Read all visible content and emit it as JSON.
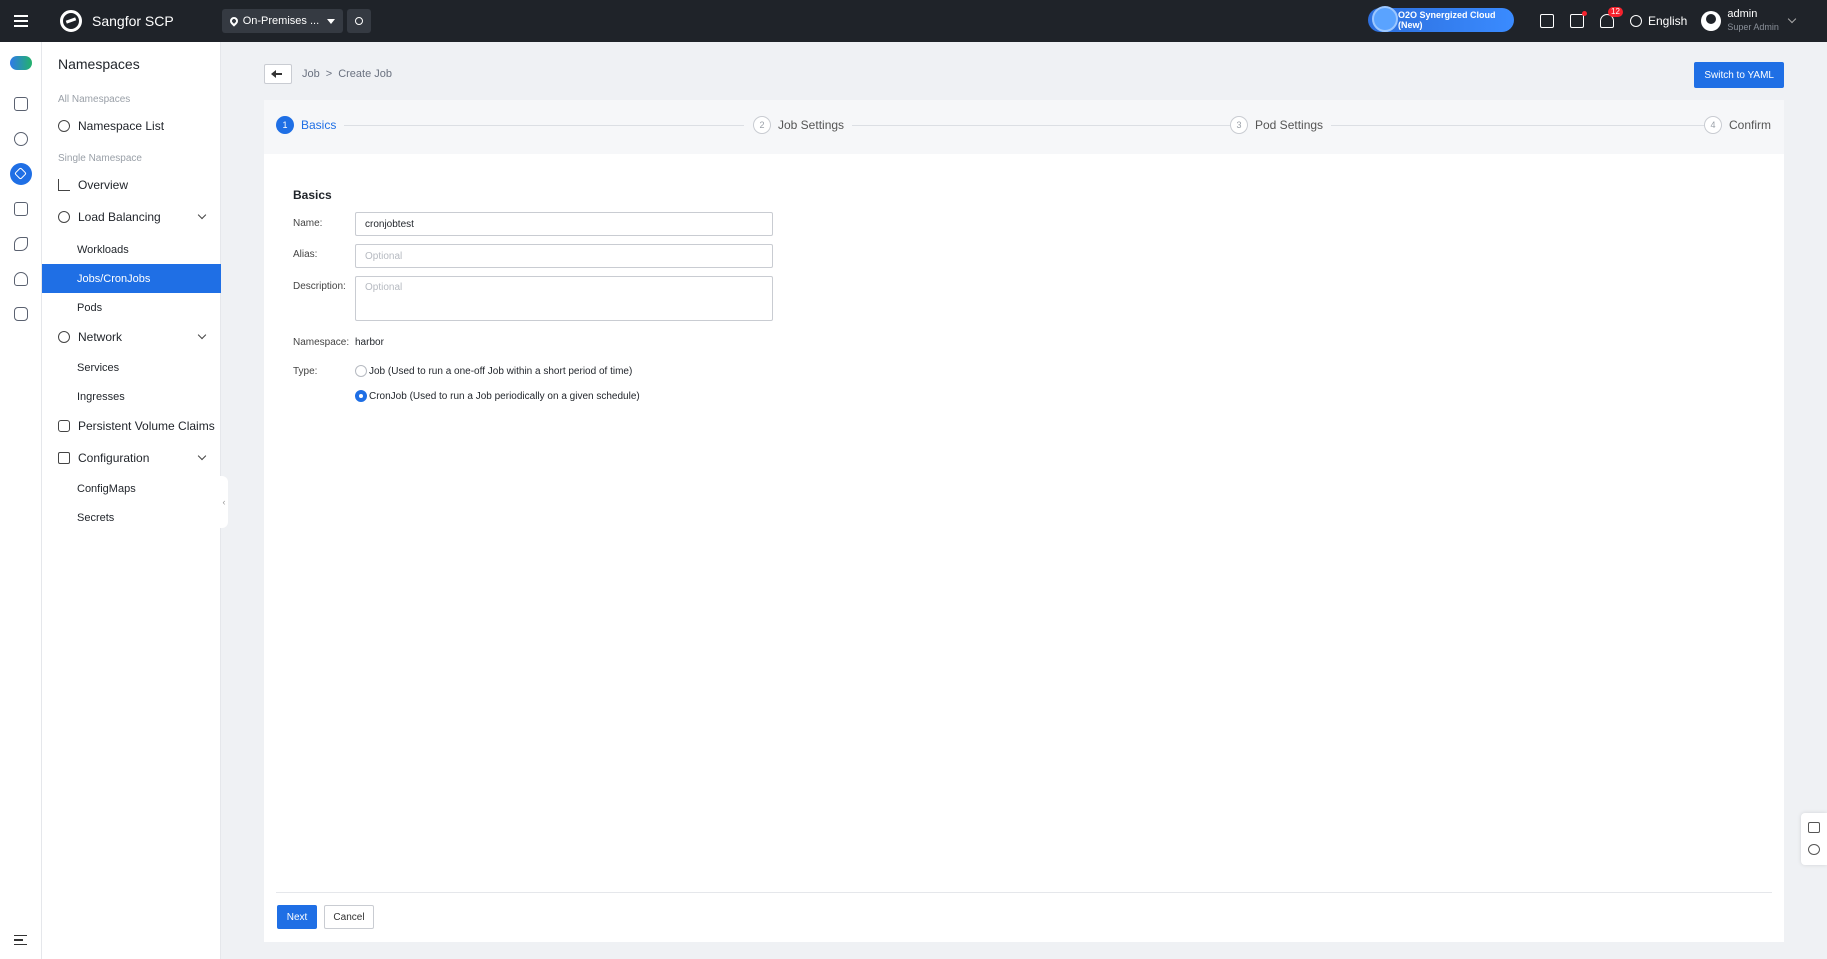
{
  "topbar": {
    "brand": "Sangfor SCP",
    "environment": "On-Premises ...",
    "promo": "O2O Synergized Cloud (New)",
    "notification_count": "12",
    "language": "English",
    "user_name": "admin",
    "user_role": "Super Admin"
  },
  "sidebar": {
    "title": "Namespaces",
    "group_all": "All Namespaces",
    "namespace_list": "Namespace List",
    "group_single": "Single Namespace",
    "overview": "Overview",
    "load_balancing": "Load Balancing",
    "workloads": "Workloads",
    "jobs_cronjobs": "Jobs/CronJobs",
    "pods": "Pods",
    "network": "Network",
    "services": "Services",
    "ingresses": "Ingresses",
    "pvc": "Persistent Volume Claims",
    "configuration": "Configuration",
    "configmaps": "ConfigMaps",
    "secrets": "Secrets"
  },
  "breadcrumb": {
    "parent": "Job",
    "separator": ">",
    "current": "Create Job"
  },
  "switch_yaml_label": "Switch to YAML",
  "steps": [
    {
      "num": "1",
      "label": "Basics"
    },
    {
      "num": "2",
      "label": "Job Settings"
    },
    {
      "num": "3",
      "label": "Pod Settings"
    },
    {
      "num": "4",
      "label": "Confirm"
    }
  ],
  "form": {
    "section_title": "Basics",
    "name_label": "Name:",
    "name_value": "cronjobtest",
    "alias_label": "Alias:",
    "alias_placeholder": "Optional",
    "description_label": "Description:",
    "description_placeholder": "Optional",
    "namespace_label": "Namespace:",
    "namespace_value": "harbor",
    "type_label": "Type:",
    "type_options": [
      {
        "label": "Job (Used to run a one-off Job within a short period of time)",
        "checked": false
      },
      {
        "label": "CronJob (Used to run a Job periodically on a given schedule)",
        "checked": true
      }
    ]
  },
  "footer": {
    "next_label": "Next",
    "cancel_label": "Cancel"
  },
  "colors": {
    "accent": "#1f6fe5",
    "topbar": "#1f2329"
  }
}
